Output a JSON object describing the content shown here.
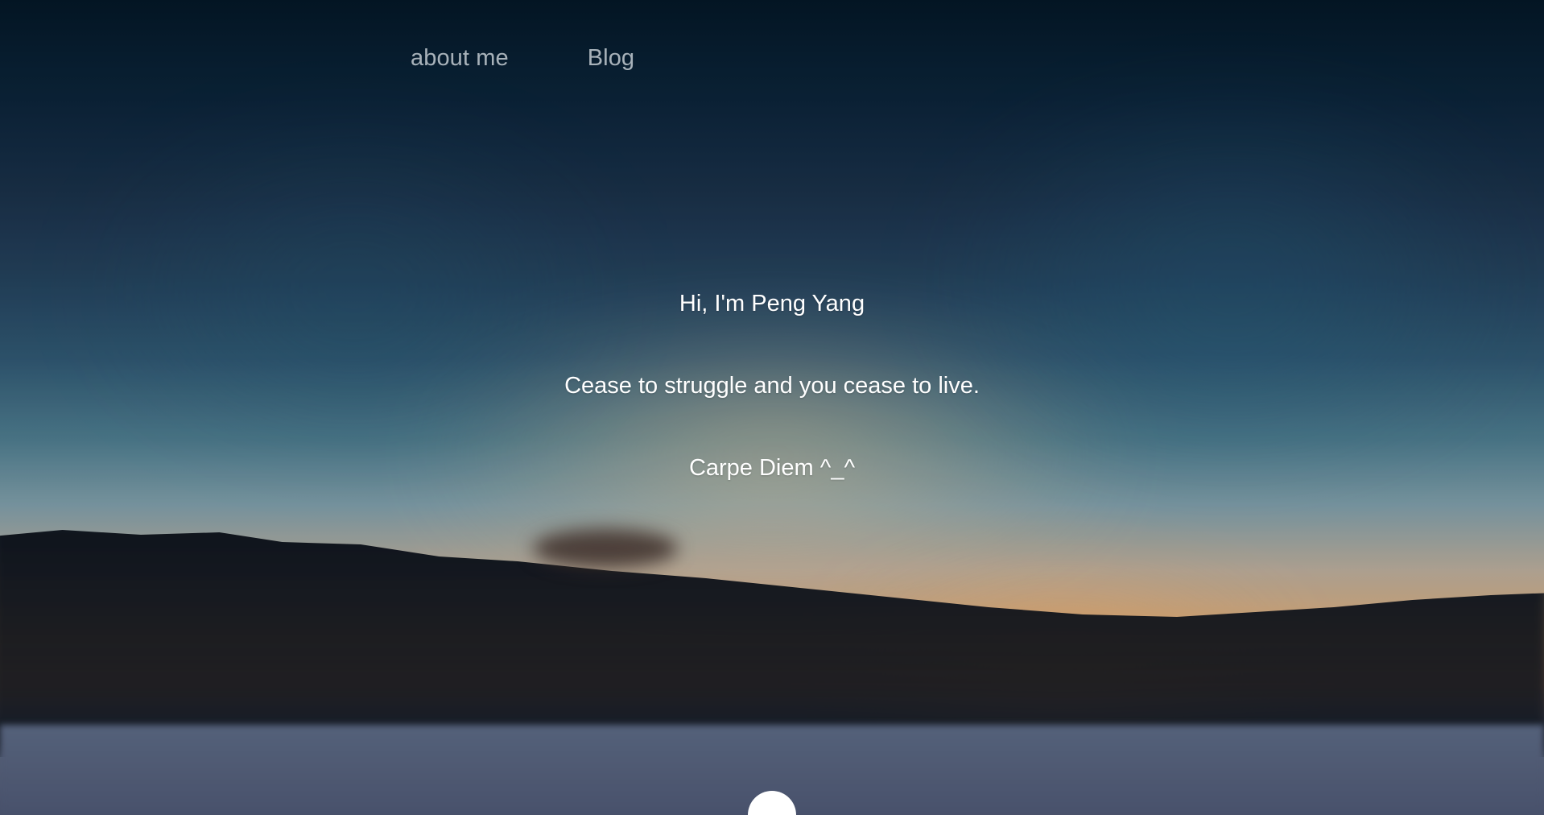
{
  "nav": {
    "items": [
      {
        "label": "about me"
      },
      {
        "label": "Blog"
      }
    ]
  },
  "hero": {
    "greeting": "Hi,   I'm Peng Yang",
    "quote": "Cease to struggle and you cease to live.",
    "tagline": "Carpe Diem ^_^"
  },
  "colors": {
    "text": "#ffffff",
    "nav_text": "#d7dde3",
    "sky_top": "#041726",
    "sunset": "#d8a672",
    "snow": "#56617a"
  },
  "icons": {
    "scroll_indicator": "circle-indicator"
  }
}
